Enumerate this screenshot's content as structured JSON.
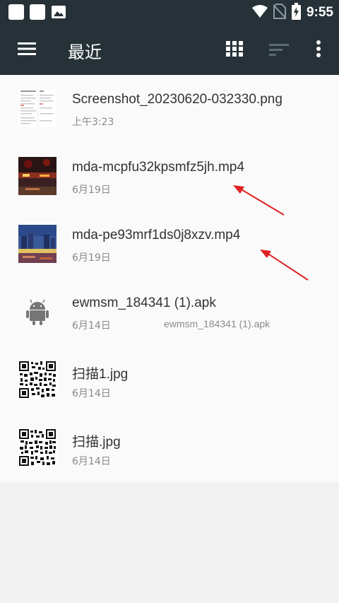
{
  "status_bar": {
    "time": "9:55",
    "icons": [
      "square-notification-icon",
      "square-notification-icon",
      "image-icon",
      "wifi-icon",
      "no-sim-icon",
      "battery-icon"
    ]
  },
  "toolbar": {
    "title": "最近",
    "menu_icon": "hamburger-icon",
    "grid_icon": "grid-view-icon",
    "sort_icon": "sort-icon",
    "more_icon": "more-vert-icon",
    "background": "#263238"
  },
  "files": [
    {
      "name": "Screenshot_20230620-032330.png",
      "date": "上午3:23",
      "summary": "",
      "thumb": "document-screenshot"
    },
    {
      "name": "mda-mcpfu32kpsmfz5jh.mp4",
      "date": "6月19日",
      "summary": "",
      "thumb": "night-city-video"
    },
    {
      "name": "mda-pe93mrf1ds0j8xzv.mp4",
      "date": "6月19日",
      "summary": "",
      "thumb": "dusk-city-video"
    },
    {
      "name": "ewmsm_184341 (1).apk",
      "date": "6月14日",
      "summary": "ewmsm_184341 (1).apk",
      "thumb": "android-icon"
    },
    {
      "name": "扫描1.jpg",
      "date": "6月14日",
      "summary": "",
      "thumb": "qr-code"
    },
    {
      "name": "扫描.jpg",
      "date": "6月14日",
      "summary": "",
      "thumb": "qr-code"
    }
  ],
  "annotation_color": "#e02020"
}
